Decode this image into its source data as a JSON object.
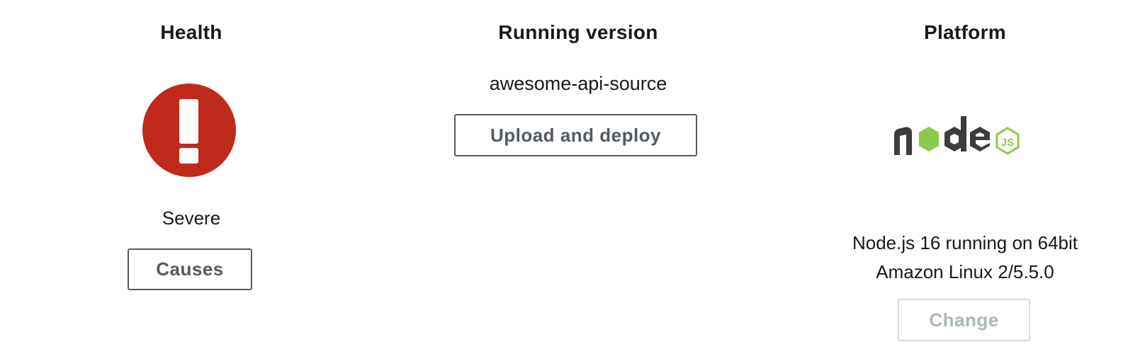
{
  "health": {
    "title": "Health",
    "status": "Severe",
    "status_icon": "exclamation-circle-icon",
    "status_color": "#bf2a1c",
    "causes_label": "Causes"
  },
  "running_version": {
    "title": "Running version",
    "version_label": "awesome-api-source",
    "deploy_label": "Upload and deploy"
  },
  "platform": {
    "title": "Platform",
    "logo": "nodejs-logo-icon",
    "description_line1": "Node.js 16 running on 64bit",
    "description_line2": "Amazon Linux 2/5.5.0",
    "change_label": "Change",
    "change_disabled": true
  },
  "colors": {
    "text": "#16191f",
    "button_border": "#545b64",
    "disabled_text": "#aab7b8",
    "node_dark": "#3c3c3c",
    "node_green": "#8cc84b"
  }
}
